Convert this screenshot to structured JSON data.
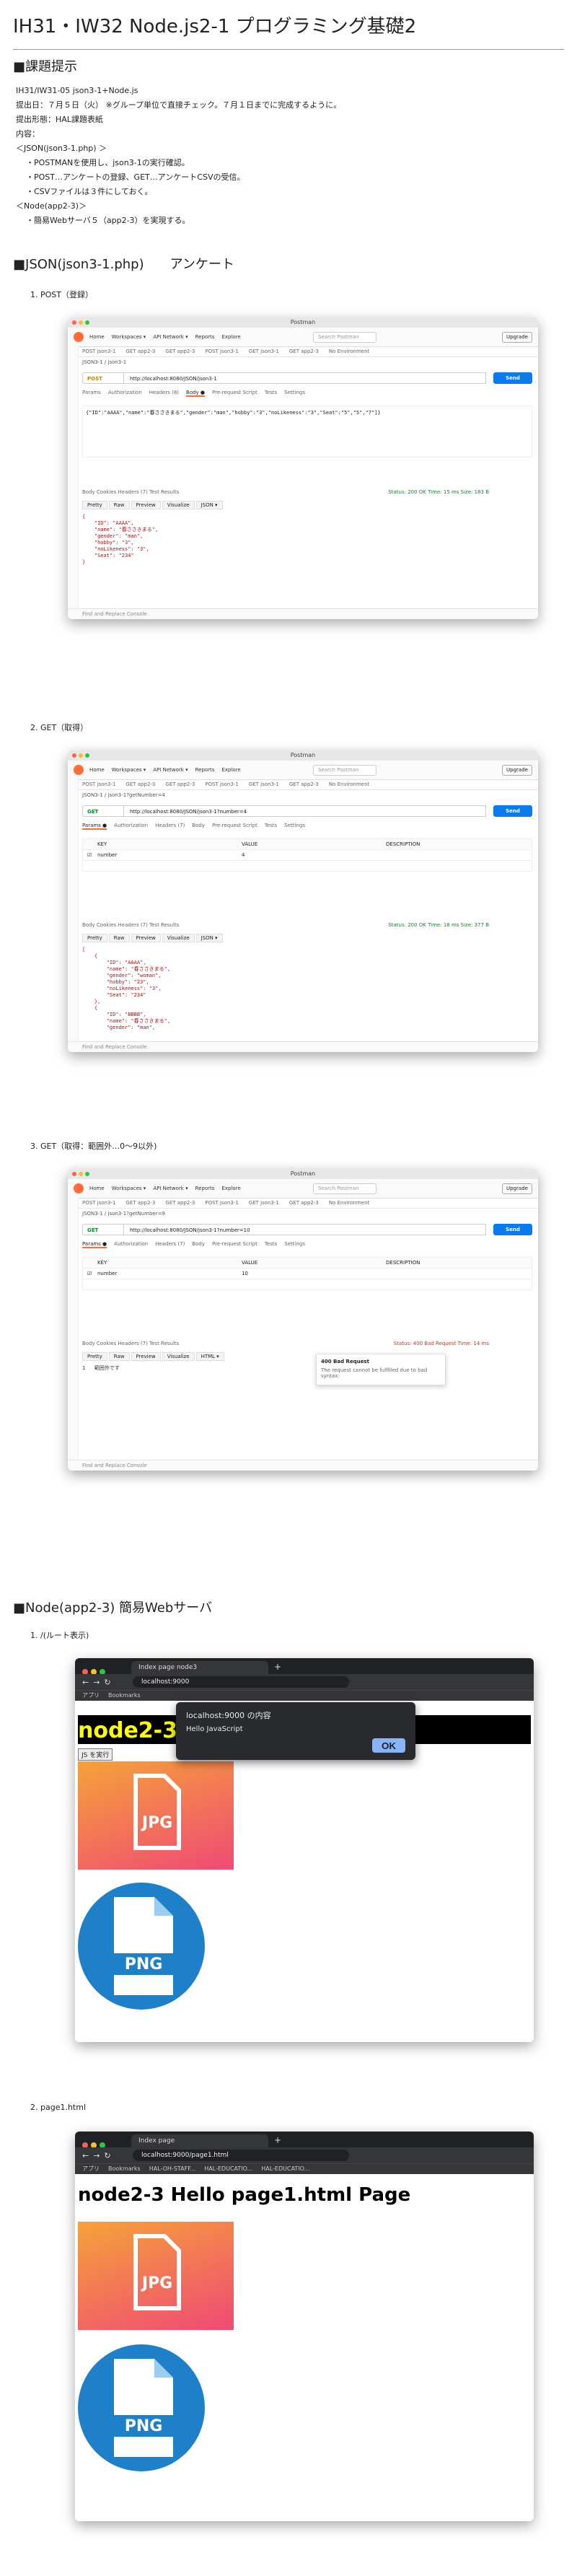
{
  "title": "IH31・IW32 Node.js2-1 プログラミング基礎2",
  "assignment": {
    "heading": "■課題提示",
    "lines": [
      "IH31/IW31-05 json3-1+Node.js",
      "提出日：７月５日（火） ※グループ単位で直接チェック。７月１日までに完成するように。",
      "提出形態：HAL課題表紙",
      "内容：",
      "＜JSON(json3-1.php) ＞"
    ],
    "items1": [
      "・POSTMANを使用し、json3-1の実行確認。",
      "・POST…アンケートの登録、GET…アンケートCSVの受信。",
      "・CSVファイルは３件にしておく。"
    ],
    "node_label": "＜Node(app2-3)＞",
    "items2": [
      "・簡易Webサーバ５（app2-3）を実現する。"
    ]
  },
  "json_section": {
    "heading": "■JSON(json3-1.php)　　アンケート",
    "sub1": "1. POST（登録）",
    "sub2": "2. GET（取得）",
    "sub3": "3. GET（取得：範囲外…0〜9以外)"
  },
  "postman": {
    "title": "Postman",
    "nav": [
      "Home",
      "Workspaces ▾",
      "API Network ▾",
      "Reports",
      "Explore"
    ],
    "search": "Search Postman",
    "upgrade": "Upgrade",
    "tabs": [
      "POST json3-1",
      "GET app2-3",
      "GET app2-3",
      "POST json3-1",
      "GET json3-1",
      "GET app2-3",
      "No Environment"
    ],
    "footer": "Find and Replace   Console",
    "send": "Send",
    "p1": {
      "crumb": "JSON3-1 / json3-1",
      "method": "POST",
      "url": "http://localhost:8080/JSON/json3-1",
      "reqtabs": [
        "Params",
        "Authorization",
        "Headers (8)",
        "Body ●",
        "Pre-request Script",
        "Tests",
        "Settings"
      ],
      "body": "{\"ID\":\"AAAA\",\"name\":\"春ささきまる\",\"gender\":\"man\",\"hobby\":\"3\",\"noLikeness\":\"3\",\"Seat\":\"5\",\"5\",\"7\"]}",
      "resbar": "Body   Cookies   Headers (7)   Test Results",
      "status": "Status: 200 OK   Time: 15 ms   Size: 183 B",
      "resopt": [
        "Pretty",
        "Raw",
        "Preview",
        "Visualize",
        "JSON ▾"
      ],
      "code": [
        "{",
        "    \"ID\": \"AAAA\",",
        "    \"name\": \"春ささきまる\",",
        "    \"gender\": \"man\",",
        "    \"hobby\": \"3\",",
        "    \"noLikeness\": \"3\",",
        "    \"Seat\": \"234\"",
        "}"
      ]
    },
    "p2": {
      "crumb": "JSON3-1 / json3-1?getNumber=4",
      "method": "GET",
      "url": "http://localhost:8080/JSON/json3-1?number=4",
      "reqtabs": [
        "Params ●",
        "Authorization",
        "Headers (7)",
        "Body",
        "Pre-request Script",
        "Tests",
        "Settings"
      ],
      "qhead": [
        "KEY",
        "VALUE",
        "DESCRIPTION"
      ],
      "qrow": [
        "number",
        "4",
        ""
      ],
      "status": "Status: 200 OK   Time: 18 ms   Size: 377 B",
      "code": [
        "[",
        "    {",
        "        \"ID\": \"AAAA\",",
        "        \"name\": \"春ささきまる\",",
        "        \"gender\": \"woman\",",
        "        \"hobby\": \"23\",",
        "        \"noLikeness\": \"3\",",
        "        \"Seat\": \"234\"",
        "    },",
        "    {",
        "        \"ID\": \"BBBB\",",
        "        \"name\": \"春ささきまる\",",
        "        \"gender\": \"man\","
      ]
    },
    "p3": {
      "crumb": "JSON3-1 / json3-1?getNumber=9",
      "method": "GET",
      "url": "http://localhost:8080/JSON/json3-1?number=10",
      "qrow": [
        "number",
        "10",
        ""
      ],
      "status": "Status: 400 Bad Request   Time: 14 ms",
      "resopt": [
        "Pretty",
        "Raw",
        "Preview",
        "Visualize",
        "HTML ▾"
      ],
      "code": [
        "1   範囲外です"
      ],
      "err_title": "400 Bad Request",
      "err_msg": "The request cannot be fulfilled due to bad syntax."
    }
  },
  "node_section": {
    "heading": "■Node(app2-3) 簡易Webサーバ",
    "sub1": "1. /(ルート表示)",
    "sub2": "2. page1.html"
  },
  "browser1": {
    "tab": "Index page node3",
    "url": "localhost:9000",
    "bookmarks": [
      "アプリ",
      "Bookmarks"
    ],
    "h1": "node2-3 Hello",
    "btn": "JS を実行",
    "alert_title": "localhost:9000 の内容",
    "alert_msg": "Hello JavaScript",
    "ok": "OK",
    "jpg": "JPG",
    "png": "PNG"
  },
  "browser2": {
    "tab": "Index page",
    "url": "localhost:9000/page1.html",
    "bookmarks": [
      "アプリ",
      "Bookmarks",
      "HAL-OH-STAFF...",
      "HAL-EDUCATIO...",
      "HAL-EDUCATIO..."
    ],
    "h1": "node2-3 Hello page1.html Page",
    "jpg": "JPG",
    "png": "PNG"
  }
}
